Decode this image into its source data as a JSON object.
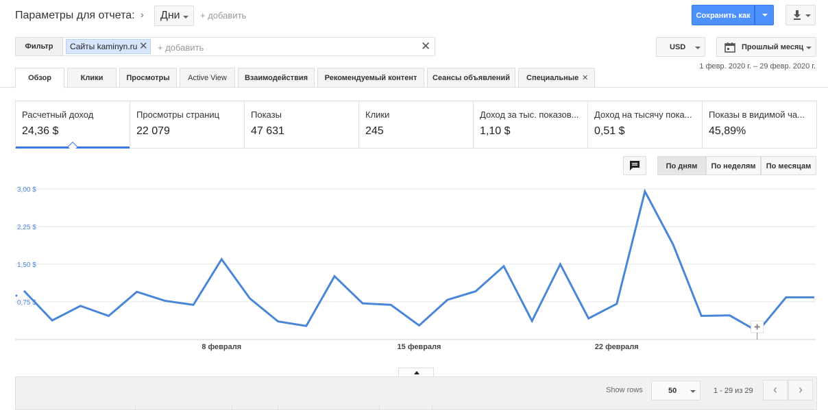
{
  "header": {
    "title": "Параметры для отчета:",
    "dimension": "Дни",
    "add_dimension": "+ добавить",
    "save_label": "Сохранить как"
  },
  "filters": {
    "label": "Фильтр",
    "chip": "Сайты kaminyn.ru",
    "add": "+ добавить",
    "currency": "USD",
    "period": "Прошлый месяц",
    "date_range": "1 февр. 2020 г. – 29 февр. 2020 г."
  },
  "tabs": [
    {
      "label": "Обзор"
    },
    {
      "label": "Клики"
    },
    {
      "label": "Просмотры"
    },
    {
      "label": "Active View"
    },
    {
      "label": "Взаимодействия"
    },
    {
      "label": "Рекомендуемый контент"
    },
    {
      "label": "Сеансы объявлений"
    },
    {
      "label": "Специальные"
    }
  ],
  "metrics": [
    {
      "name": "Расчетный доход",
      "value": "24,36 $"
    },
    {
      "name": "Просмотры страниц",
      "value": "22 079"
    },
    {
      "name": "Показы",
      "value": "47 631"
    },
    {
      "name": "Клики",
      "value": "245"
    },
    {
      "name": "Доход за тыс. показов...",
      "value": "1,10 $"
    },
    {
      "name": "Доход на тысячу пока...",
      "value": "0,51 $"
    },
    {
      "name": "Показы в видимой ча...",
      "value": "45,89%"
    }
  ],
  "granularity": [
    "По дням",
    "По неделям",
    "По месяцам"
  ],
  "table": {
    "show_rows_label": "Show rows",
    "rows_value": "50",
    "range": "1 - 29 из 29"
  },
  "colors": {
    "primary": "#4d90fe",
    "line": "#4a86d8",
    "accent": "#3b78e7"
  },
  "chart_data": {
    "type": "line",
    "yticks": [
      "3,00 $",
      "2,25 $",
      "1,50 $",
      "0,75 $"
    ],
    "ylim": [
      0,
      3.0
    ],
    "xtick_labels": [
      {
        "day": 8,
        "label": "8 февраля"
      },
      {
        "day": 15,
        "label": "15 февраля"
      },
      {
        "day": 22,
        "label": "22 февраля"
      }
    ],
    "x": [
      1,
      2,
      3,
      4,
      5,
      6,
      7,
      8,
      9,
      10,
      11,
      12,
      13,
      14,
      15,
      16,
      17,
      18,
      19,
      20,
      21,
      22,
      23,
      24,
      25,
      26,
      27,
      28,
      29
    ],
    "series": [
      {
        "values": [
          0.97,
          0.38,
          0.67,
          0.47,
          0.95,
          0.77,
          0.69,
          1.6,
          0.82,
          0.36,
          0.27,
          1.26,
          0.72,
          0.69,
          0.28,
          0.79,
          0.96,
          1.46,
          0.37,
          1.5,
          0.42,
          0.71,
          2.95,
          1.89,
          0.47,
          0.48,
          0.16,
          0.84,
          0.84
        ]
      }
    ]
  }
}
